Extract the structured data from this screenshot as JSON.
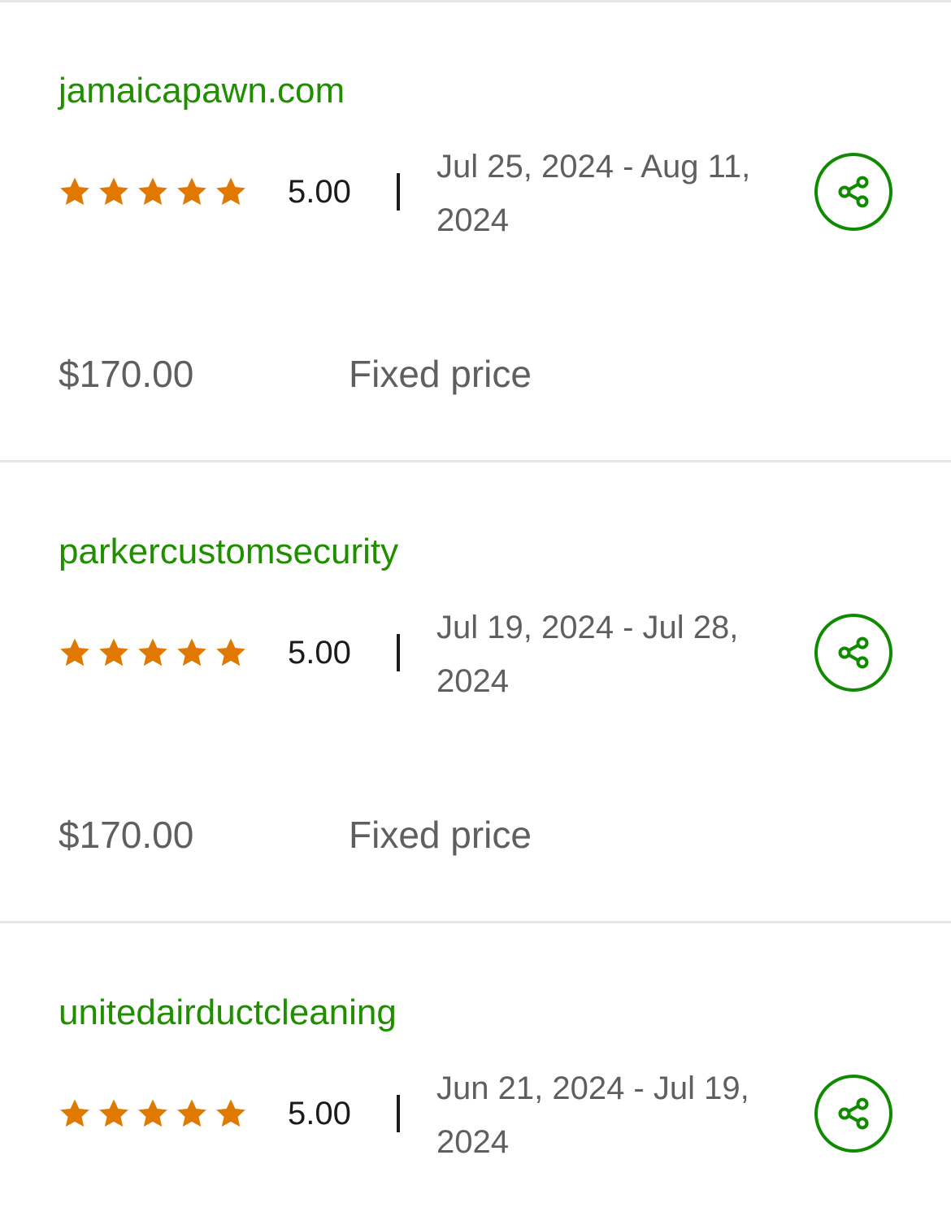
{
  "colors": {
    "title": "#1f8f00",
    "star": "#e17800",
    "share_icon": "#108a00",
    "meta_text": "#5f5f5f",
    "divider": "#e6e6e6"
  },
  "items": [
    {
      "title": "jamaicapawn.com",
      "rating": "5.00",
      "stars": 5,
      "dates": "Jul 25, 2024 - Aug 11, 2024",
      "price": "$170.00",
      "price_type": "Fixed price",
      "share_icon": "share-icon"
    },
    {
      "title": "parkercustomsecurity",
      "rating": "5.00",
      "stars": 5,
      "dates": "Jul 19, 2024 - Jul 28, 2024",
      "price": "$170.00",
      "price_type": "Fixed price",
      "share_icon": "share-icon"
    },
    {
      "title": "unitedairductcleaning",
      "rating": "5.00",
      "stars": 5,
      "dates": "Jun 21, 2024 - Jul 19, 2024",
      "share_icon": "share-icon"
    }
  ]
}
